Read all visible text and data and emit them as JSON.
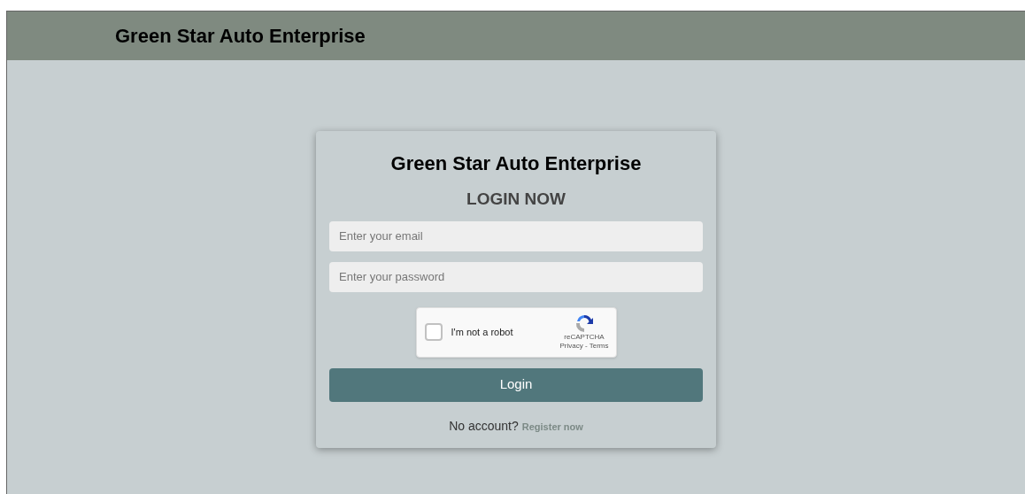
{
  "header": {
    "title": "Green Star Auto Enterprise"
  },
  "card": {
    "title": "Green Star Auto Enterprise",
    "subtitle": "LOGIN NOW",
    "fields": [
      {
        "placeholder": "Enter your email"
      },
      {
        "placeholder": "Enter your password"
      }
    ],
    "captcha": {
      "label": "I'm not a robot",
      "checked": false,
      "brand": "reCAPTCHA",
      "links": "Privacy - Terms"
    },
    "button": "Login",
    "footer": {
      "text": "No account?",
      "link": "Register now"
    }
  }
}
